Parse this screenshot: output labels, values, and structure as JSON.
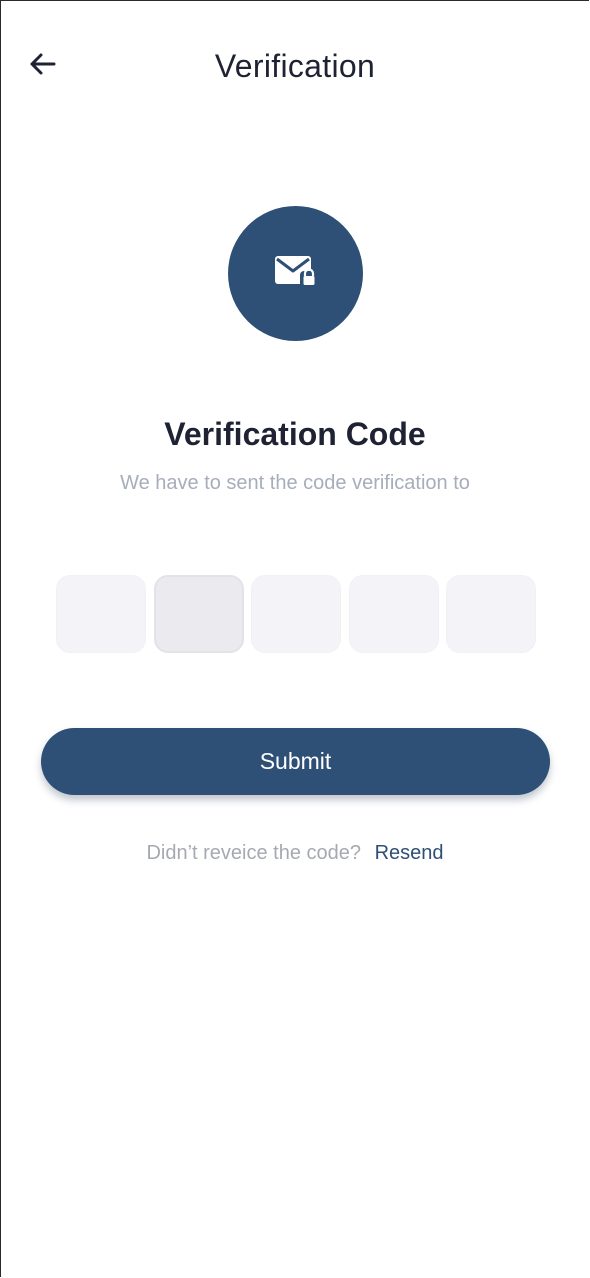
{
  "header": {
    "back_icon": "arrow-left-icon",
    "title": "Verification"
  },
  "hero": {
    "icon": "mail-lock-icon",
    "heading": "Verification Code",
    "subtitle": "We have to sent the code verification to"
  },
  "code_input": {
    "box_count": 5,
    "values": [
      "",
      "",
      "",
      "",
      ""
    ],
    "active_index": 1
  },
  "submit": {
    "label": "Submit"
  },
  "resend": {
    "prompt": "Didn’t reveice the code?",
    "link_label": "Resend"
  },
  "colors": {
    "primary": "#2e4f76",
    "text_dark": "#1e2233",
    "text_muted": "#a7adbb",
    "box_bg": "#f4f4f8"
  }
}
